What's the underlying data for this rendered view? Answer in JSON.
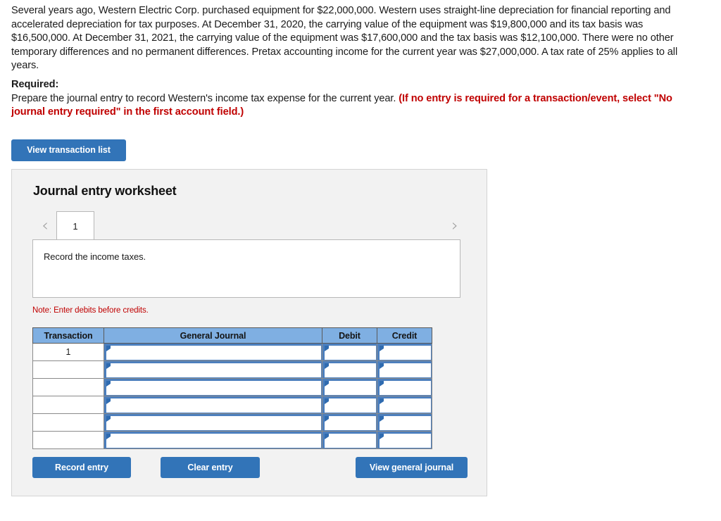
{
  "problem": {
    "paragraph": "Several years ago, Western Electric Corp. purchased equipment for $22,000,000. Western uses straight-line depreciation for financial reporting and accelerated depreciation for tax purposes. At December 31, 2020, the carrying value of the equipment was $19,800,000 and its tax basis was $16,500,000. At December 31, 2021, the carrying value of the equipment was $17,600,000 and the tax basis was $12,100,000. There were no other temporary differences and no permanent differences. Pretax accounting income for the current year was $27,000,000. A tax rate of 25% applies to all years."
  },
  "required": {
    "label": "Required:",
    "text": "Prepare the journal entry to record Western's income tax expense for the current year.",
    "note_red": "(If no entry is required for a transaction/event, select \"No journal entry required\" in the first account field.)"
  },
  "buttons": {
    "view_transaction_list": "View transaction list",
    "record_entry": "Record entry",
    "clear_entry": "Clear entry",
    "view_general_journal": "View general journal"
  },
  "worksheet": {
    "title": "Journal entry worksheet",
    "prev_icon": "chevron-left-icon",
    "next_icon": "chevron-right-icon",
    "tabs": [
      {
        "label": "1",
        "active": true
      }
    ],
    "description": "Record the income taxes.",
    "note": "Note: Enter debits before credits.",
    "table": {
      "headers": [
        "Transaction",
        "General Journal",
        "Debit",
        "Credit"
      ],
      "rows": [
        {
          "transaction": "1",
          "general_journal": "",
          "debit": "",
          "credit": ""
        },
        {
          "transaction": "",
          "general_journal": "",
          "debit": "",
          "credit": ""
        },
        {
          "transaction": "",
          "general_journal": "",
          "debit": "",
          "credit": ""
        },
        {
          "transaction": "",
          "general_journal": "",
          "debit": "",
          "credit": ""
        },
        {
          "transaction": "",
          "general_journal": "",
          "debit": "",
          "credit": ""
        },
        {
          "transaction": "",
          "general_journal": "",
          "debit": "",
          "credit": ""
        }
      ]
    }
  },
  "colors": {
    "button_blue": "#3274b8",
    "header_blue": "#7fafe2",
    "input_border_blue": "#4c7fbe",
    "alert_red": "#c00000",
    "panel_bg": "#f2f2f2"
  }
}
